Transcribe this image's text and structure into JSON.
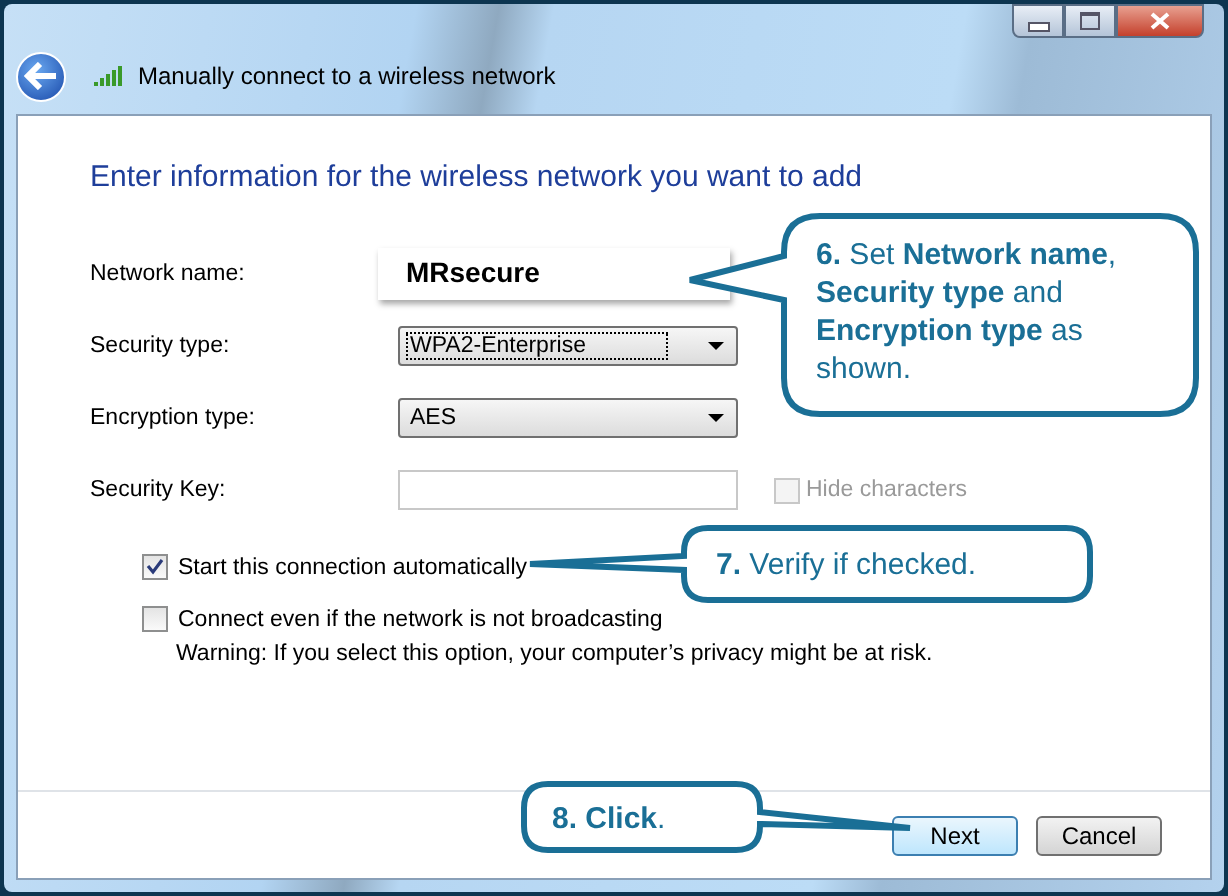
{
  "window": {
    "title": "Manually connect to a wireless network"
  },
  "heading": "Enter information for the wireless network you want to add",
  "fields": [
    {
      "kind": "text",
      "label": "Network name:",
      "value": "MRsecure",
      "focused": false
    },
    {
      "kind": "dropdown",
      "label": "Security type:",
      "value": "WPA2-Enterprise",
      "focused": true
    },
    {
      "kind": "dropdown",
      "label": "Encryption type:",
      "value": "AES",
      "focused": false
    },
    {
      "kind": "password",
      "label": "Security Key:",
      "focused": false
    }
  ],
  "hide_characters": {
    "label": "Hide characters",
    "checked": false,
    "disabled": true
  },
  "options": [
    {
      "label": "Start this connection automatically",
      "checked": true
    },
    {
      "label": "Connect even if the network is not broadcasting",
      "checked": false
    }
  ],
  "warning": "Warning: If you select this option, your computer’s privacy might be at risk.",
  "buttons": [
    {
      "label": "Next",
      "default": true
    },
    {
      "label": "Cancel",
      "default": false
    }
  ],
  "callouts": [
    {
      "text": "**6.** Set **Network name**, **Security type** and **Encryption type** as shown."
    },
    {
      "text": "**7.** Verify if checked."
    },
    {
      "text": "**8. Click**."
    }
  ]
}
